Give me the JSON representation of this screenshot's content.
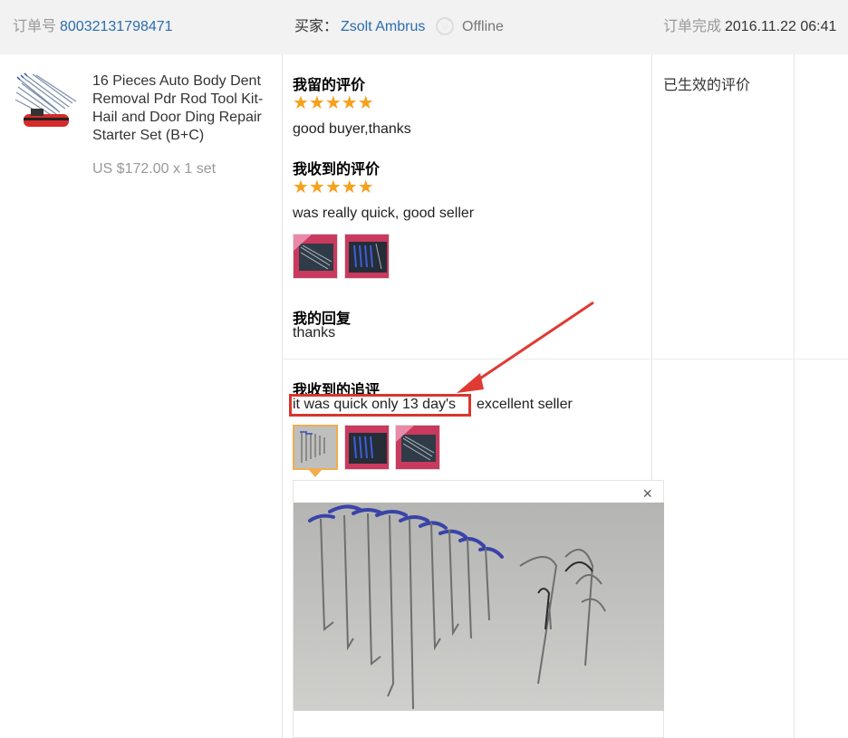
{
  "header": {
    "order_label": "订单号",
    "order_number": "80032131798471",
    "buyer_label": "买家：",
    "buyer_name": "Zsolt Ambrus",
    "buyer_status": "Offline",
    "completed_label": "订单完成",
    "completed_time": "2016.11.22 06:41"
  },
  "product": {
    "title": "16 Pieces Auto Body Dent Removal Pdr Rod Tool Kit-Hail and Door Ding Repair Starter Set (B+C)",
    "price": "US $172.00 x 1 set",
    "thumb_icon": "tool-kit-thumbnail"
  },
  "review_left": {
    "label": "我留的评价",
    "stars": "★★★★★",
    "rating": 5,
    "text": "good buyer,thanks"
  },
  "review_received": {
    "label": "我收到的评价",
    "stars": "★★★★★",
    "rating": 5,
    "text": "was really quick, good seller"
  },
  "reply": {
    "label": "我的回复",
    "text": "thanks"
  },
  "followup": {
    "label": "我收到的追评",
    "highlighted_text": "it was quick only 13 day's",
    "rest_text": "excellent seller"
  },
  "status": {
    "label": "已生效的评价"
  },
  "preview": {
    "close_glyph": "×"
  },
  "colors": {
    "star": "#f7a01c",
    "link": "#2a6db0",
    "highlight": "#d9362c",
    "active_thumb": "#f0ad4e"
  }
}
